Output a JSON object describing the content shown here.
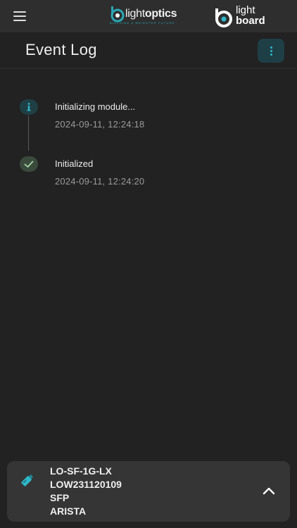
{
  "app": {
    "brand_left": {
      "part1": "light",
      "part2": "optics",
      "tagline": "BUILDING A BRIGHTER FUTURE"
    },
    "brand_right": {
      "line1": "light",
      "line2": "board"
    },
    "menu_icon": "hamburger-menu-icon"
  },
  "page": {
    "title": "Event Log",
    "more_icon": "vertical-dots-icon"
  },
  "events": [
    {
      "icon": "info-icon",
      "message": "Initializing module...",
      "timestamp": "2024-09-11, 12:24:18"
    },
    {
      "icon": "check-icon",
      "message": "Initialized",
      "timestamp": "2024-09-11, 12:24:20"
    }
  ],
  "device": {
    "icon": "transceiver-icon",
    "model": "LO-SF-1G-LX",
    "serial": "LOW231120109",
    "form_factor": "SFP",
    "vendor": "ARISTA",
    "expand_icon": "chevron-up-icon"
  },
  "colors": {
    "background": "#222222",
    "topbar": "#2e2e2e",
    "accent": "#2fb8c9",
    "card": "#353535"
  }
}
